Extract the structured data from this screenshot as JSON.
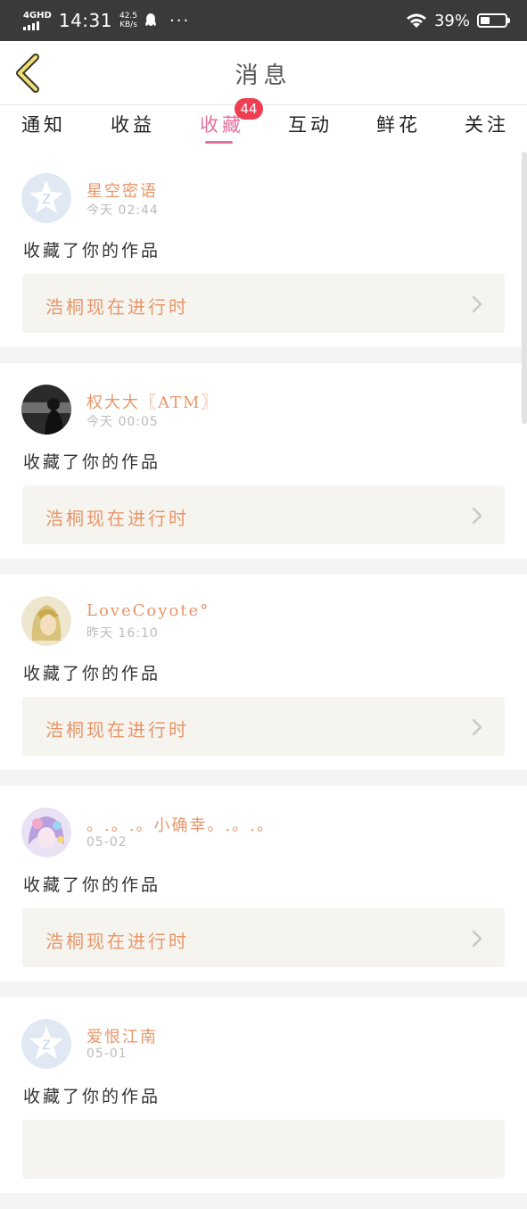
{
  "status_bar": {
    "network": "4GHD",
    "time": "14:31",
    "speed_value": "42.5",
    "speed_unit": "KB/s",
    "more": "···",
    "battery_text": "39%",
    "battery_level": 0.39
  },
  "header": {
    "title": "消息"
  },
  "tabs": [
    {
      "label": "通知"
    },
    {
      "label": "收益"
    },
    {
      "label": "收藏",
      "badge": "44"
    },
    {
      "label": "互动"
    },
    {
      "label": "鲜花"
    },
    {
      "label": "关注"
    }
  ],
  "active_tab": "收藏",
  "accent_color": "#e4709f",
  "name_color": "#e8966a",
  "messages": [
    {
      "username": "星空密语",
      "time": "今天 02:44",
      "action": "收藏了你的作品",
      "work_title": "浩桐现在进行时",
      "avatar": "default-avatar-icon"
    },
    {
      "username": "权大大〖ATM〗",
      "time": "今天 00:05",
      "action": "收藏了你的作品",
      "work_title": "浩桐现在进行时",
      "avatar": "dark-photo-avatar"
    },
    {
      "username": "LoveCoyote°",
      "time": "昨天 16:10",
      "action": "收藏了你的作品",
      "work_title": "浩桐现在进行时",
      "avatar": "blonde-anime-avatar"
    },
    {
      "username": "。.。.。小确幸。.。.。",
      "time": "05-02",
      "action": "收藏了你的作品",
      "work_title": "浩桐现在进行时",
      "avatar": "colorful-anime-avatar"
    },
    {
      "username": "爱恨江南",
      "time": "05-01",
      "action": "收藏了你的作品",
      "work_title": "",
      "avatar": "default-avatar-icon"
    }
  ]
}
